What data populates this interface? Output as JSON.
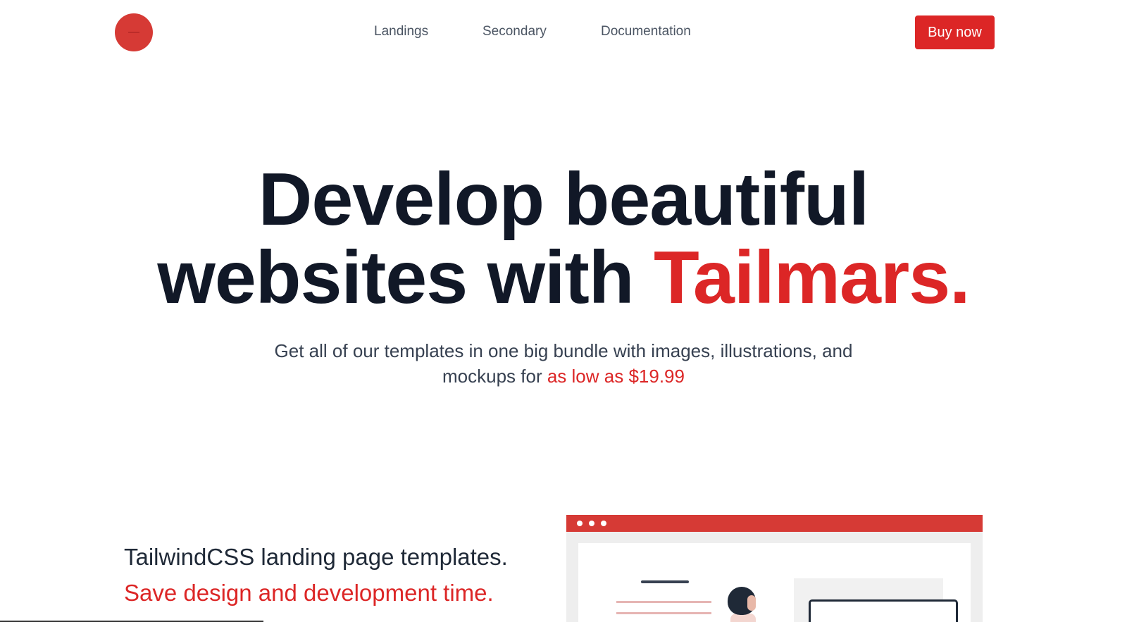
{
  "header": {
    "logo_icon": "circle-logo-icon",
    "nav": [
      {
        "label": "Landings"
      },
      {
        "label": "Secondary"
      },
      {
        "label": "Documentation"
      }
    ],
    "buy_label": "Buy now"
  },
  "hero": {
    "title_line1": "Develop beautiful",
    "title_line2_prefix": "websites with",
    "title_accent": "Tailmars.",
    "subtitle": "Get all of our templates in one big bundle with images, illustrations, and mockups for",
    "price_text": "as low as $19.99"
  },
  "feature": {
    "line1": "TailwindCSS landing page templates.",
    "line2": "Save design and development time."
  },
  "colors": {
    "accent": "#dc2626",
    "heading": "#111827",
    "body_text": "#374151",
    "nav_text": "#4b5563"
  }
}
